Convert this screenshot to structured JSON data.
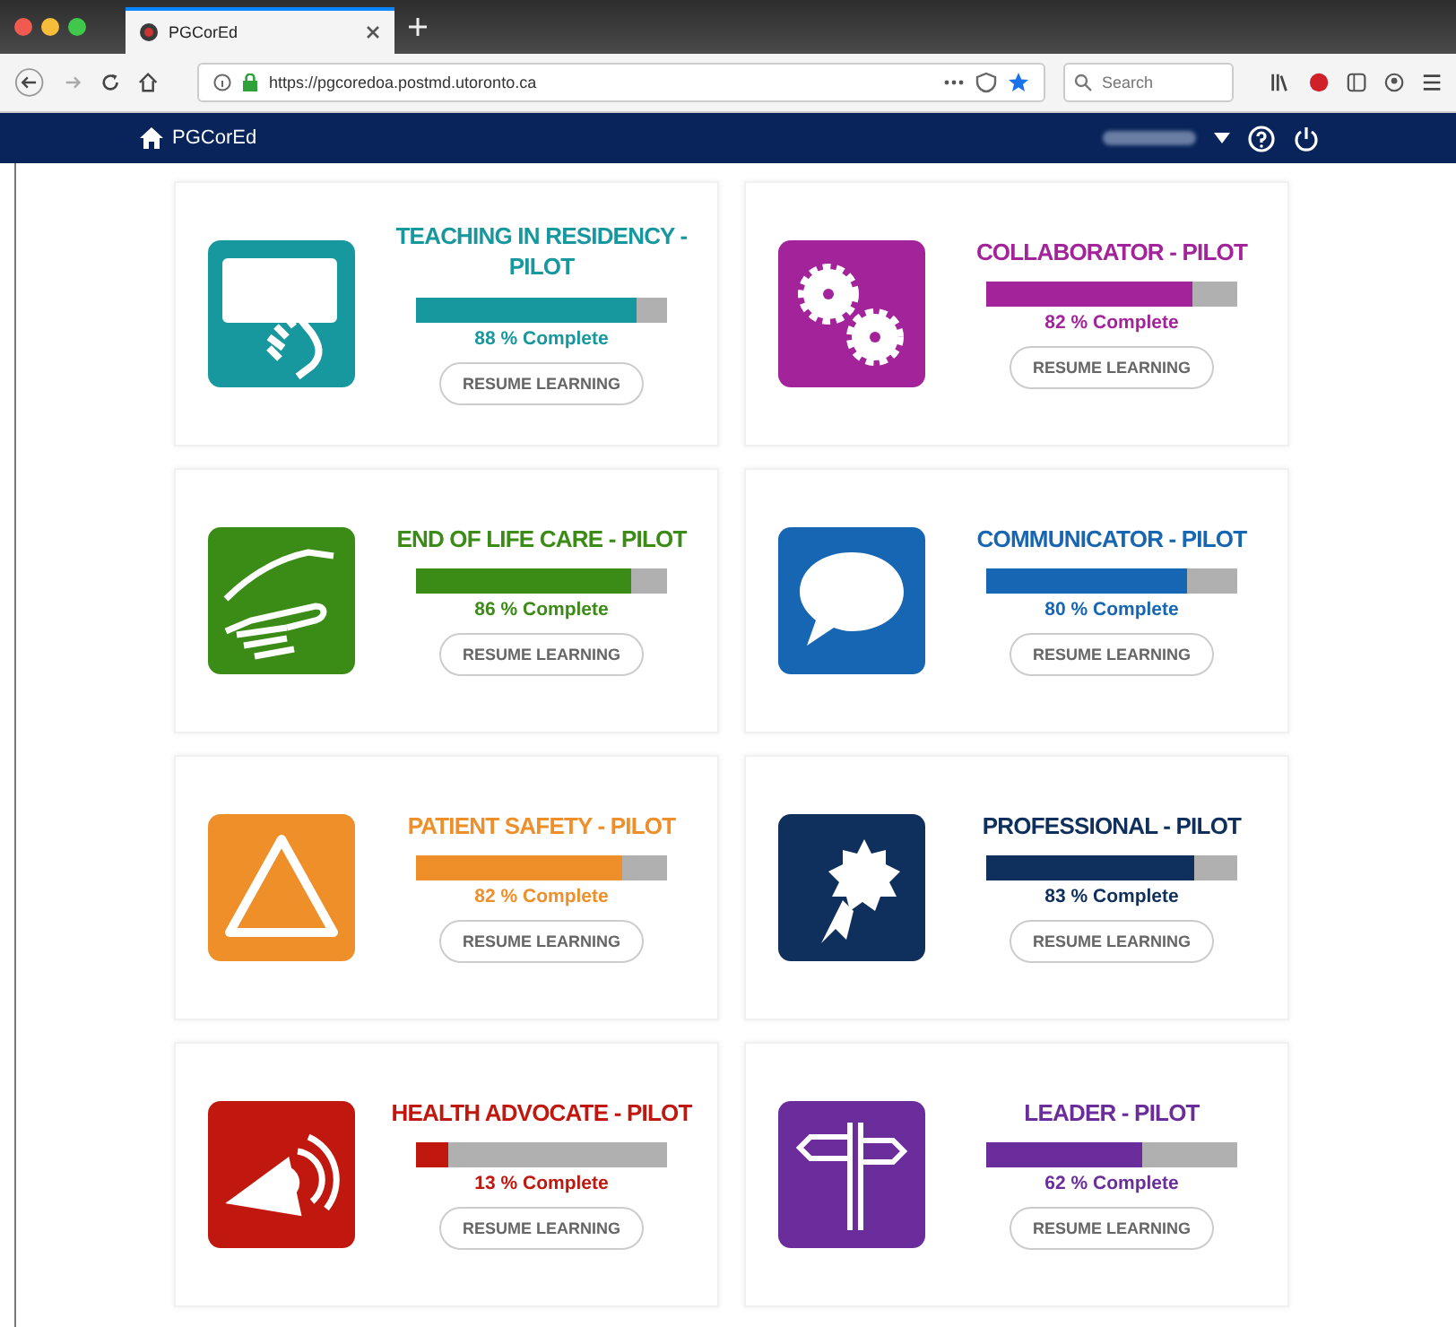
{
  "browser": {
    "tab_title": "PGCorEd",
    "url": "https://pgcoredoa.postmd.utoronto.ca",
    "search": {
      "placeholder": "Search"
    }
  },
  "header": {
    "title": "PGCorEd"
  },
  "courses": [
    {
      "title": "TEACHING IN RESIDENCY - PILOT",
      "kind": "touch",
      "color": "#17979e",
      "level": 0.88,
      "progress_text": "88 % Complete",
      "button": "RESUME LEARNING"
    },
    {
      "title": "COLLABORATOR - PILOT",
      "kind": "gears",
      "color": "#a3239b",
      "level": 0.82,
      "progress_text": "82 % Complete",
      "button": "RESUME LEARNING"
    },
    {
      "title": "END OF LIFE CARE - PILOT",
      "kind": "hands",
      "color": "#3b8c17",
      "level": 0.86,
      "progress_text": "86 % Complete",
      "button": "RESUME LEARNING"
    },
    {
      "title": "COMMUNICATOR - PILOT",
      "kind": "speech",
      "color": "#1766b3",
      "level": 0.8,
      "progress_text": "80 % Complete",
      "button": "RESUME LEARNING"
    },
    {
      "title": "PATIENT SAFETY - PILOT",
      "kind": "triangle",
      "color": "#ee8f2a",
      "level": 0.82,
      "progress_text": "82 % Complete",
      "button": "RESUME LEARNING"
    },
    {
      "title": "PROFESSIONAL - PILOT",
      "kind": "award",
      "color": "#0f2f5c",
      "level": 0.83,
      "progress_text": "83 % Complete",
      "button": "RESUME LEARNING"
    },
    {
      "title": "HEALTH ADVOCATE - PILOT",
      "kind": "megaphone",
      "color": "#c0170e",
      "level": 0.13,
      "progress_text": "13 % Complete",
      "button": "RESUME LEARNING"
    },
    {
      "title": "LEADER - PILOT",
      "kind": "signpost",
      "color": "#6b2c9c",
      "level": 0.62,
      "progress_text": "62 % Complete",
      "button": "RESUME LEARNING"
    }
  ]
}
